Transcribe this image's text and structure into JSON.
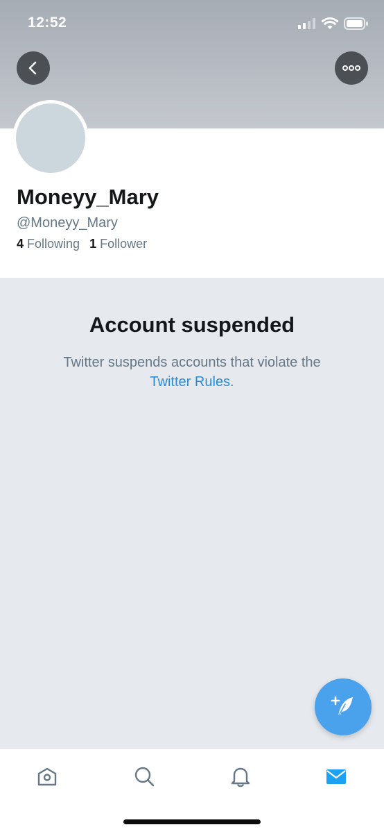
{
  "status_bar": {
    "time": "12:52"
  },
  "header": {
    "back_icon": "chevron-left-icon",
    "more_icon": "more-horizontal-icon"
  },
  "profile": {
    "display_name": "Moneyy_Mary",
    "handle": "@Moneyy_Mary",
    "following_count": "4",
    "following_label": "Following",
    "followers_count": "1",
    "followers_label": "Follower"
  },
  "suspension": {
    "title": "Account suspended",
    "message": "Twitter suspends accounts that violate the",
    "link_text": "Twitter Rules",
    "trailing": "."
  },
  "compose": {
    "icon": "compose-feather-icon"
  },
  "tab_bar": {
    "tabs": [
      {
        "name": "home",
        "icon": "home-icon"
      },
      {
        "name": "search",
        "icon": "search-icon"
      },
      {
        "name": "notifications",
        "icon": "bell-icon"
      },
      {
        "name": "messages",
        "icon": "mail-icon",
        "active": true
      }
    ]
  },
  "colors": {
    "accent": "#1da1f2",
    "link": "#2b8ad6",
    "page_background": "#e6e9ee",
    "text_primary": "#14171a",
    "text_secondary": "#657786"
  }
}
